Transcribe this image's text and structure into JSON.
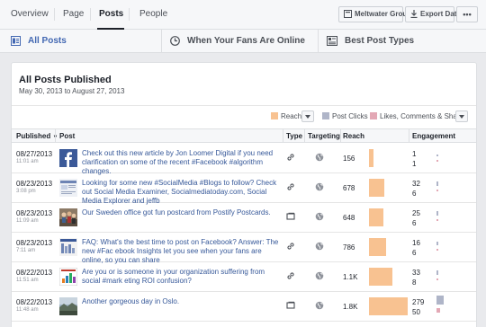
{
  "topnav": {
    "tabs": [
      "Overview",
      "Page",
      "Posts",
      "People"
    ],
    "active_tab": "Posts",
    "account_label": "Meltwater Group",
    "export_label": "Export Data",
    "more_label": "•••"
  },
  "subnav": {
    "items": [
      "All Posts",
      "When Your Fans Are Online",
      "Best Post Types"
    ],
    "active": "All Posts"
  },
  "card": {
    "title": "All Posts Published",
    "date_range": "May 30, 2013 to August 27, 2013"
  },
  "legend": {
    "reach": "Reach",
    "post_clicks": "Post Clicks",
    "likes": "Likes, Comments & Shares",
    "colors": {
      "reach": "#f8c291",
      "post_clicks": "#afb5c8",
      "likes": "#e3a8b5"
    }
  },
  "table": {
    "headers": [
      "Published",
      "Post",
      "Type",
      "Targeting",
      "Reach",
      "Engagement"
    ],
    "rows": [
      {
        "date": "08/27/2013",
        "time": "11:01 am",
        "thumb": "facebook-logo-thumb",
        "text": "Check out this new article by Jon Loomer Digital if you need clarification on some of the recent #Facebook #algorithm changes.",
        "type": "link",
        "reach": "156",
        "reach_frac": 0.1,
        "eng1": "1",
        "eng2": "1",
        "e1_frac": 0.05,
        "e2_frac": 0.05
      },
      {
        "date": "08/23/2013",
        "time": "3:08 pm",
        "thumb": "blog-article-thumb",
        "text": "Looking for some new #SocialMedia #Blogs to follow? Check out Social Media Examiner, Socialmediatoday.com, Social Media Explorer and jeffb",
        "type": "link",
        "reach": "678",
        "reach_frac": 0.35,
        "eng1": "32",
        "eng2": "6",
        "e1_frac": 0.5,
        "e2_frac": 0.25
      },
      {
        "date": "08/23/2013",
        "time": "11:09 am",
        "thumb": "group-photo-thumb",
        "text": "Our Sweden office got fun postcard from Postify Postcards.",
        "type": "photo",
        "reach": "648",
        "reach_frac": 0.33,
        "eng1": "25",
        "eng2": "6",
        "e1_frac": 0.45,
        "e2_frac": 0.25
      },
      {
        "date": "08/23/2013",
        "time": "7:11 am",
        "thumb": "infographic-thumb",
        "text": "FAQ: What's the best time to post on Facebook? Answer: The new #Fac ebook Insights let you see when your fans are online, so you can share",
        "type": "link",
        "reach": "786",
        "reach_frac": 0.4,
        "eng1": "16",
        "eng2": "6",
        "e1_frac": 0.4,
        "e2_frac": 0.25
      },
      {
        "date": "08/22/2013",
        "time": "11:51 am",
        "thumb": "chart-article-thumb",
        "text": "Are you or is someone in your organization suffering from social #mark eting ROI confusion?",
        "type": "link",
        "reach": "1.1K",
        "reach_frac": 0.55,
        "eng1": "33",
        "eng2": "8",
        "e1_frac": 0.5,
        "e2_frac": 0.3
      },
      {
        "date": "08/22/2013",
        "time": "11:48 am",
        "thumb": "landscape-photo-thumb",
        "text": "Another gorgeous day in Oslo.",
        "type": "photo",
        "reach": "1.8K",
        "reach_frac": 0.9,
        "eng1": "279",
        "eng2": "50",
        "e1_frac": 1.0,
        "e2_frac": 0.6,
        "e1_color": "#afb5c8",
        "e2_color": "#e3a8b5"
      }
    ]
  }
}
